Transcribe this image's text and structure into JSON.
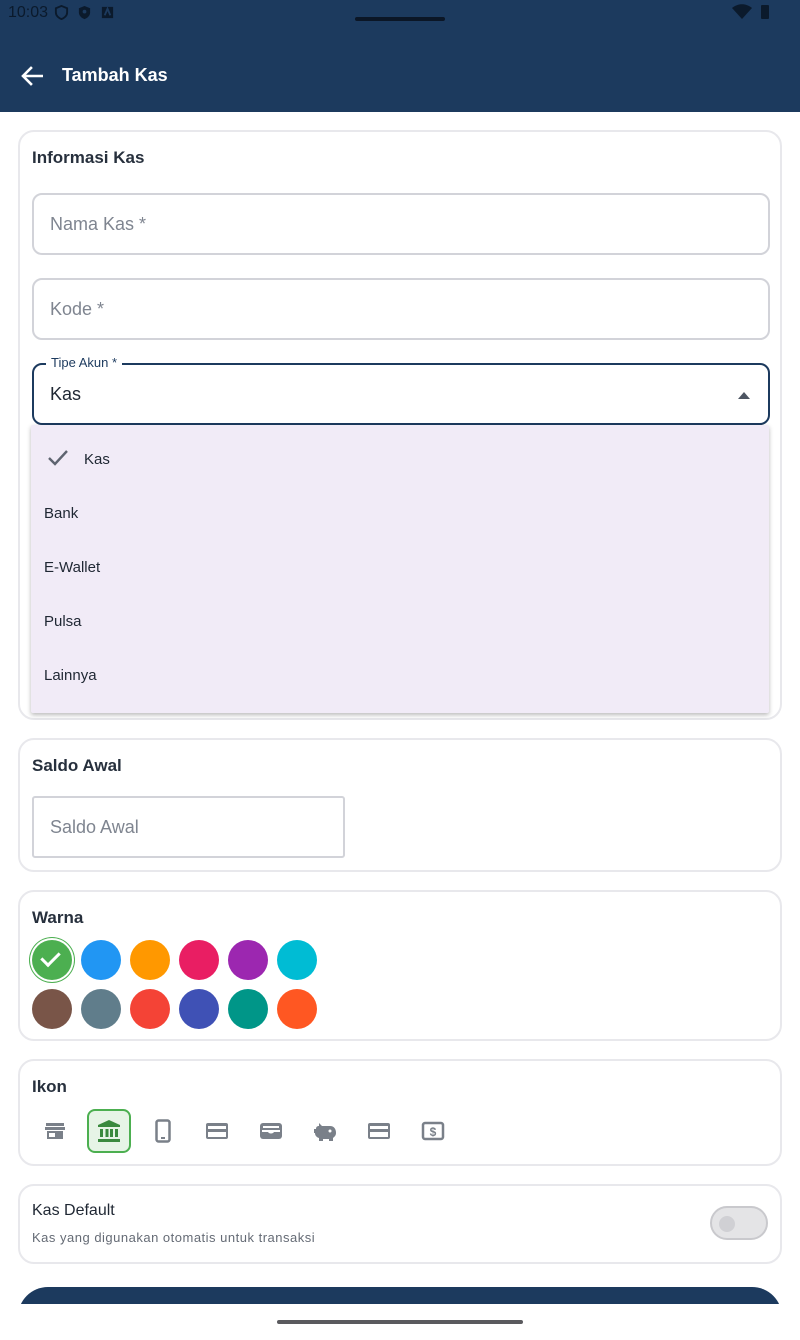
{
  "status": {
    "time": "10:03"
  },
  "appbar": {
    "title": "Tambah Kas"
  },
  "info_card": {
    "title": "Informasi Kas",
    "name_placeholder": "Nama Kas *",
    "code_placeholder": "Kode *",
    "type_label": "Tipe Akun *",
    "type_value": "Kas"
  },
  "type_menu": {
    "items": [
      {
        "label": "Kas",
        "selected": true
      },
      {
        "label": "Bank",
        "selected": false
      },
      {
        "label": "E-Wallet",
        "selected": false
      },
      {
        "label": "Pulsa",
        "selected": false
      },
      {
        "label": "Lainnya",
        "selected": false
      }
    ]
  },
  "saldo_card": {
    "title": "Saldo Awal",
    "placeholder": "Saldo Awal"
  },
  "color_card": {
    "title": "Warna",
    "selected": "#4caf50",
    "colors": [
      "#4caf50",
      "#2196f3",
      "#ff9800",
      "#e91e63",
      "#9c27b0",
      "#00bcd4",
      "#795548",
      "#607d8b",
      "#f44336",
      "#3f51b5",
      "#009688",
      "#ff5722"
    ]
  },
  "icon_card": {
    "title": "Ikon",
    "icons": [
      "store-icon",
      "bank-icon",
      "phone-icon",
      "credit-card-icon",
      "wallet-icon",
      "piggy-bank-icon",
      "card-icon",
      "cash-icon"
    ],
    "selected": "bank-icon"
  },
  "default_card": {
    "title": "Kas Default",
    "subtitle": "Kas yang digunakan otomatis untuk transaksi",
    "enabled": false
  }
}
